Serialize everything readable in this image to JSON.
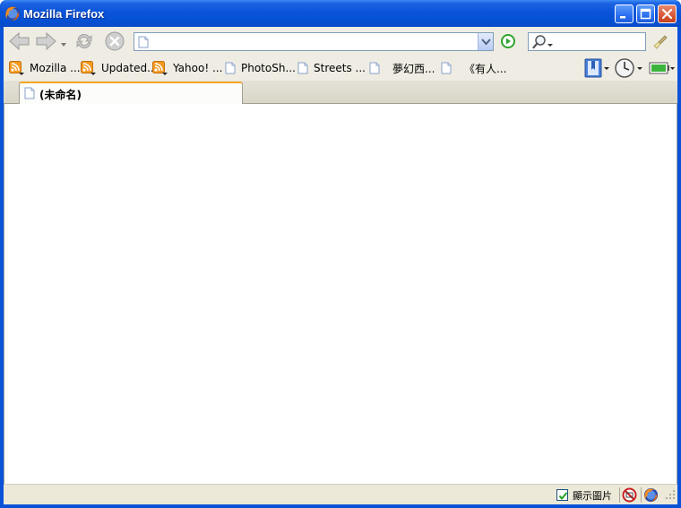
{
  "window": {
    "title": "Mozilla Firefox",
    "icons": {
      "app": "firefox-logo-icon",
      "minimize": "minimize-icon",
      "maximize": "maximize-icon",
      "close": "close-icon"
    }
  },
  "navbar": {
    "url_value": "",
    "search_value": "",
    "icons": {
      "back": "back-arrow-icon",
      "forward": "forward-arrow-icon",
      "history_dropdown": "chevron-down-icon",
      "reload": "reload-icon",
      "stop": "stop-icon",
      "url_page": "page-icon",
      "url_dropdown": "chevron-down-icon",
      "go": "go-icon",
      "search": "magnifier-icon",
      "clear": "broom-icon"
    }
  },
  "bookmarks": {
    "items": [
      {
        "label": "Mozilla ...",
        "icon": "rss-icon"
      },
      {
        "label": "Updated...",
        "icon": "rss-icon"
      },
      {
        "label": "Yahoo! ...",
        "icon": "rss-icon"
      },
      {
        "label": "PhotoSh...",
        "icon": "page-icon"
      },
      {
        "label": "Streets ...",
        "icon": "page-icon"
      },
      {
        "label": "夢幻西...",
        "icon": "page-icon"
      },
      {
        "label": "《有人...",
        "icon": "page-icon"
      }
    ],
    "right_icons": [
      "bookmarks-menu-icon",
      "clock-icon",
      "battery-icon"
    ]
  },
  "tabs": [
    {
      "label": "(未命名)",
      "active": true,
      "icon": "page-icon"
    }
  ],
  "statusbar": {
    "show_images_label": "顯示圖片",
    "show_images_checked": true,
    "icons": [
      "popup-blocked-icon",
      "firefox-logo-icon"
    ]
  },
  "colors": {
    "titlebar": "#0a54d9",
    "chrome": "#ece9d8",
    "tab_accent": "#f5a623",
    "go_green": "#2fa52f"
  }
}
